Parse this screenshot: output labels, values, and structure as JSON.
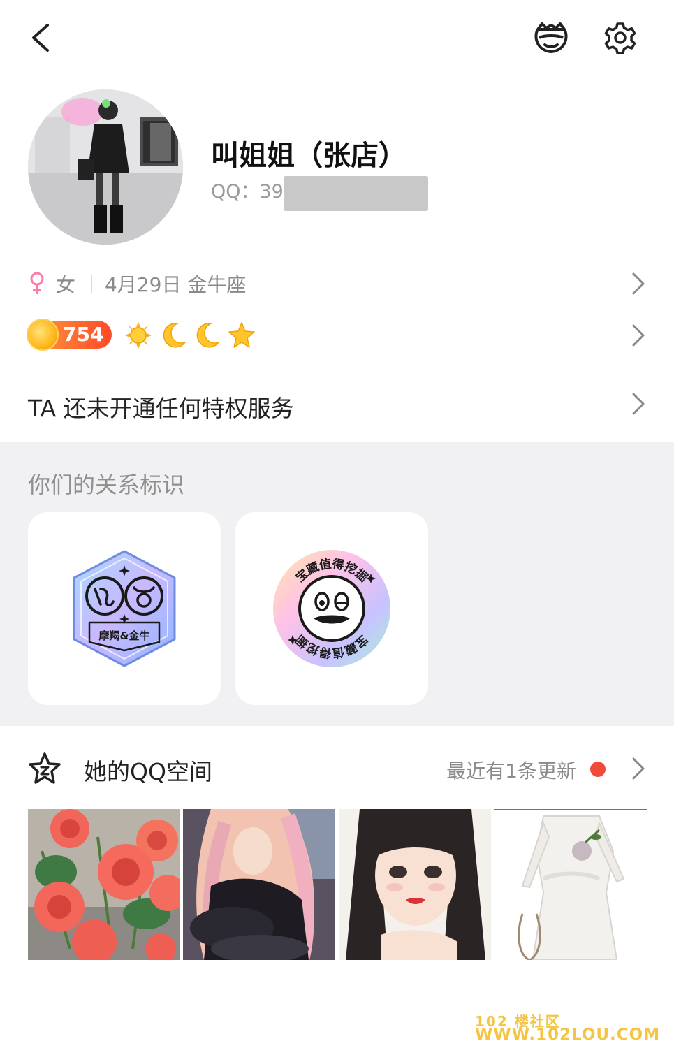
{
  "profile": {
    "nickname": "叫姐姐（张店）",
    "qq_label": "QQ：39"
  },
  "info": {
    "gender": "女",
    "birthday": "4月29日 金牛座"
  },
  "level": {
    "value": "754",
    "icons": [
      "sun-icon",
      "moon-icon",
      "moon-icon",
      "star-icon"
    ]
  },
  "privilege": {
    "text": "TA 还未开通任何特权服务"
  },
  "relationship": {
    "title": "你们的关系标识",
    "badges": [
      {
        "icon": "zodiac-badge-icon",
        "label": "摩羯&金牛"
      },
      {
        "icon": "treasure-badge-icon",
        "label": "宝藏值得挖掘"
      }
    ]
  },
  "qzone": {
    "title": "她的QQ空间",
    "update_text": "最近有1条更新",
    "photos": [
      "roses-photo",
      "anime-girl-photo",
      "illustrated-girl-photo",
      "white-dress-photo"
    ]
  },
  "watermark": {
    "line1": "102 楼社区",
    "line2": "WWW.102LOU.COM"
  },
  "colors": {
    "accent_red": "#f04a3a",
    "section_bg": "#f1f1f3",
    "level_badge": "#ff4a2a"
  }
}
